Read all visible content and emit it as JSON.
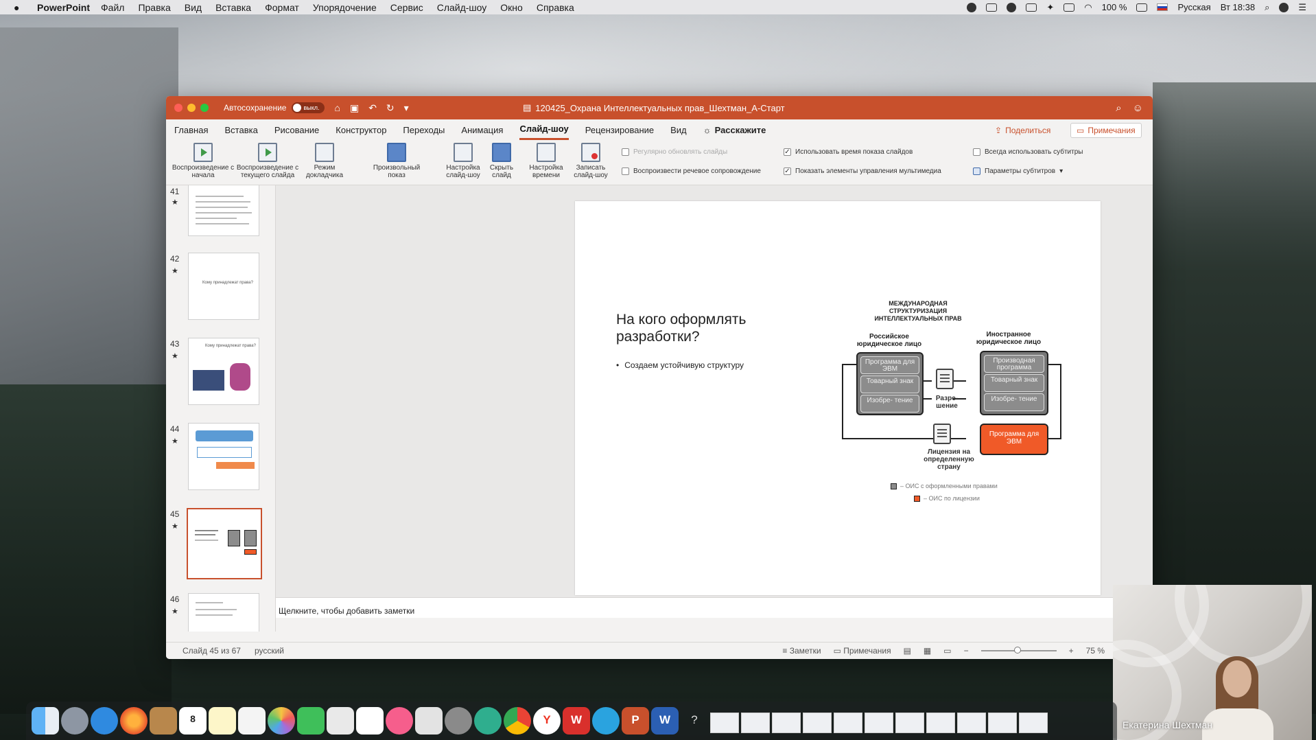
{
  "menubar": {
    "app": "PowerPoint",
    "items": [
      "Файл",
      "Правка",
      "Вид",
      "Вставка",
      "Формат",
      "Упорядочение",
      "Сервис",
      "Слайд-шоу",
      "Окно",
      "Справка"
    ],
    "battery": "100 %",
    "input_language": "Русская",
    "clock": "Вт 18:38"
  },
  "titlebar": {
    "autosave_label": "Автосохранение",
    "autosave_state": "выкл.",
    "document_title": "120425_Охрана Интеллектуальных прав_Шехтман_А-Старт"
  },
  "tabs": [
    "Главная",
    "Вставка",
    "Рисование",
    "Конструктор",
    "Переходы",
    "Анимация",
    "Слайд-шоу",
    "Рецензирование",
    "Вид"
  ],
  "active_tab": "Слайд-шоу",
  "tell_me": "Расскажите",
  "share_label": "Поделиться",
  "comments_label": "Примечания",
  "ribbon": {
    "play_from_start": "Воспроизведение с начала",
    "play_from_current": "Воспроизведение с текущего слайда",
    "presenter_mode": "Режим докладчика",
    "custom_show": "Произвольный показ",
    "setup_show": "Настройка слайд-шоу",
    "hide_slide": "Скрыть слайд",
    "rehearse_timings": "Настройка времени",
    "record_show": "Записать слайд-шоу",
    "opt_update_slides": "Регулярно обновлять слайды",
    "opt_play_narration": "Воспроизвести речевое сопровождение",
    "opt_use_timings": "Использовать время показа слайдов",
    "opt_show_media_controls": "Показать элементы управления мультимедиа",
    "opt_always_subtitles": "Всегда использовать субтитры",
    "subtitle_settings": "Параметры субтитров"
  },
  "thumbnails": [
    {
      "num": "41",
      "text": ""
    },
    {
      "num": "42",
      "text": "Кому принадлежат права?"
    },
    {
      "num": "43",
      "text": "Кому принадлежат права?"
    },
    {
      "num": "44",
      "text": ""
    },
    {
      "num": "45",
      "text": ""
    },
    {
      "num": "46",
      "text": ""
    }
  ],
  "slide": {
    "title": "На кого оформлять разработки?",
    "bullet": "Создаем устойчивую структуру",
    "diagram": {
      "title": "МЕЖДУНАРОДНАЯ СТРУКТУРИЗАЦИЯ ИНТЕЛЛЕКТУАЛЬНЫХ ПРАВ",
      "left_label": "Российское юридическое лицо",
      "right_label": "Иностранное юридическое лицо",
      "left_items": [
        "Программа для ЭВМ",
        "Товарный знак",
        "Изобре- тение"
      ],
      "right_items": [
        "Производная программа",
        "Товарный знак",
        "Изобре- тение"
      ],
      "orange_item": "Программа для ЭВМ",
      "middle_label": "Разре- шение",
      "license_label": "Лицензия на определенную страну",
      "legend_registered": "– ОИС с оформленными правами",
      "legend_licensed": "– ОИС по лицензии"
    }
  },
  "notes_placeholder": "Щелкните, чтобы добавить заметки",
  "status": {
    "slide_info": "Слайд 45 из 67",
    "language": "русский",
    "notes": "Заметки",
    "comments": "Примечания",
    "zoom": "75 %"
  },
  "webcam": {
    "name": "Екатерина Шехтман"
  },
  "colors": {
    "accent": "#c8502c",
    "orange": "#f05a28"
  }
}
